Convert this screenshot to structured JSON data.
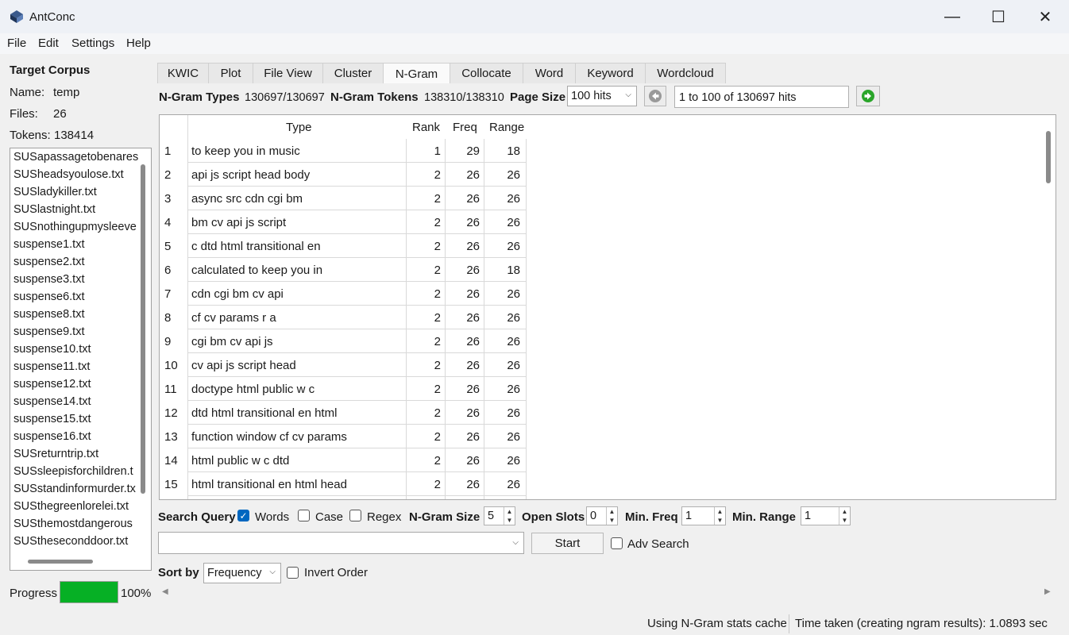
{
  "window": {
    "title": "AntConc",
    "minimize": "—",
    "maximize": "☐",
    "close": "✕"
  },
  "menu": [
    "File",
    "Edit",
    "Settings",
    "Help"
  ],
  "corpus": {
    "heading": "Target Corpus",
    "name_label": "Name:",
    "name": "temp",
    "files_label": "Files:",
    "files": "26",
    "tokens_label": "Tokens:",
    "tokens": "138414",
    "file_list": [
      "SUSapassagetobenares",
      "SUSheadsyoulose.txt",
      "SUSladykiller.txt",
      "SUSlastnight.txt",
      "SUSnothingupmysleeve",
      "suspense1.txt",
      "suspense2.txt",
      "suspense3.txt",
      "suspense6.txt",
      "suspense8.txt",
      "suspense9.txt",
      "suspense10.txt",
      "suspense11.txt",
      "suspense12.txt",
      "suspense14.txt",
      "suspense15.txt",
      "suspense16.txt",
      "SUSreturntrip.txt",
      "SUSsleepisforchildren.t",
      "SUSstandinformurder.tx",
      "SUSthegreenlorelei.txt",
      "SUSthemostdangerous",
      "SUStheseconddoor.txt"
    ]
  },
  "progress": {
    "label": "Progress",
    "percent_text": "100%",
    "fraction": 1.0
  },
  "tabs": [
    "KWIC",
    "Plot",
    "File View",
    "Cluster",
    "N-Gram",
    "Collocate",
    "Word",
    "Keyword",
    "Wordcloud"
  ],
  "active_tab": "N-Gram",
  "stats": {
    "types_label": "N-Gram Types",
    "types": "130697/130697",
    "tokens_label": "N-Gram Tokens",
    "tokens": "138310/138310",
    "page_size_label": "Page Size",
    "page_size": "100 hits",
    "hits": "1 to 100 of 130697 hits"
  },
  "table": {
    "headers": [
      "Type",
      "Rank",
      "Freq",
      "Range"
    ],
    "rows": [
      {
        "n": "1",
        "type": "to keep you in music",
        "rank": "1",
        "freq": "29",
        "range": "18"
      },
      {
        "n": "2",
        "type": "api js script head body",
        "rank": "2",
        "freq": "26",
        "range": "26"
      },
      {
        "n": "3",
        "type": "async src cdn cgi bm",
        "rank": "2",
        "freq": "26",
        "range": "26"
      },
      {
        "n": "4",
        "type": "bm cv api js script",
        "rank": "2",
        "freq": "26",
        "range": "26"
      },
      {
        "n": "5",
        "type": "c dtd html transitional en",
        "rank": "2",
        "freq": "26",
        "range": "26"
      },
      {
        "n": "6",
        "type": "calculated to keep you in",
        "rank": "2",
        "freq": "26",
        "range": "18"
      },
      {
        "n": "7",
        "type": "cdn cgi bm cv api",
        "rank": "2",
        "freq": "26",
        "range": "26"
      },
      {
        "n": "8",
        "type": "cf cv params r a",
        "rank": "2",
        "freq": "26",
        "range": "26"
      },
      {
        "n": "9",
        "type": "cgi bm cv api js",
        "rank": "2",
        "freq": "26",
        "range": "26"
      },
      {
        "n": "10",
        "type": "cv api js script head",
        "rank": "2",
        "freq": "26",
        "range": "26"
      },
      {
        "n": "11",
        "type": "doctype html public w c",
        "rank": "2",
        "freq": "26",
        "range": "26"
      },
      {
        "n": "12",
        "type": "dtd html transitional en html",
        "rank": "2",
        "freq": "26",
        "range": "26"
      },
      {
        "n": "13",
        "type": "function window cf cv params",
        "rank": "2",
        "freq": "26",
        "range": "26"
      },
      {
        "n": "14",
        "type": "html public w c dtd",
        "rank": "2",
        "freq": "26",
        "range": "26"
      },
      {
        "n": "15",
        "type": "html transitional en html head",
        "rank": "2",
        "freq": "26",
        "range": "26"
      }
    ]
  },
  "search": {
    "query_label": "Search Query",
    "words_label": "Words",
    "words_checked": true,
    "case_label": "Case",
    "case_checked": false,
    "regex_label": "Regex",
    "regex_checked": false,
    "ngram_size_label": "N-Gram Size",
    "ngram_size": "5",
    "open_slots_label": "Open Slots",
    "open_slots": "0",
    "min_freq_label": "Min. Freq",
    "min_freq": "1",
    "min_range_label": "Min. Range",
    "min_range": "1",
    "query_value": "",
    "start_label": "Start",
    "adv_search_label": "Adv Search",
    "adv_search_checked": false
  },
  "sort": {
    "label": "Sort by",
    "value": "Frequency",
    "invert_label": "Invert Order",
    "invert_checked": false
  },
  "status": {
    "cache": "Using N-Gram stats cache",
    "time": "Time taken (creating ngram results):  1.0893 sec"
  },
  "colors": {
    "progress": "#06b025",
    "checkbox_checked": "#0067c0",
    "next_button": "#2aa52a"
  }
}
